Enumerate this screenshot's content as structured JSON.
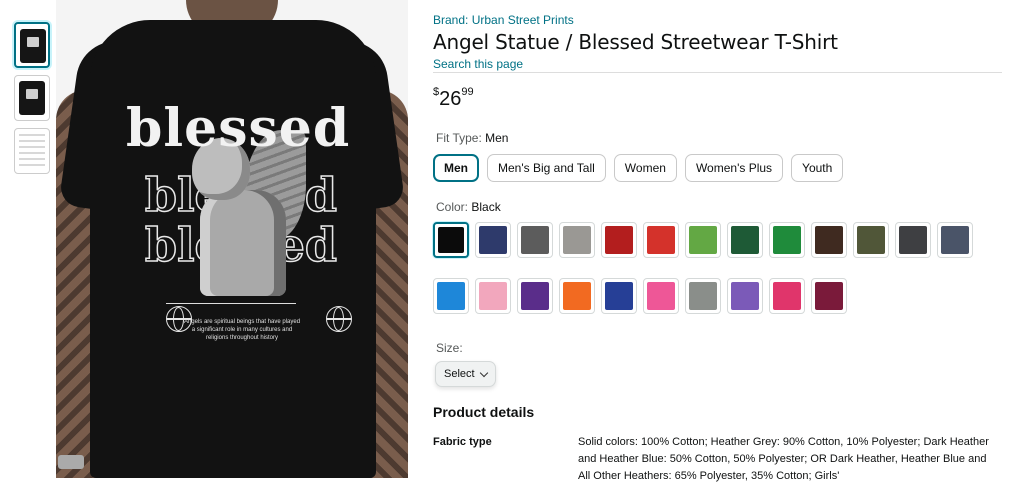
{
  "thumbnails": [
    "shirt-back-print",
    "shirt-front",
    "size-chart"
  ],
  "print": {
    "headline": "blessed",
    "outline_word": "blessed",
    "caption": "Angels are spiritual beings that have played a significant role in many cultures and religions throughout history"
  },
  "brand_link": "Brand: Urban Street Prints",
  "title": "Angel Statue / Blessed Streetwear T-Shirt",
  "search_link": "Search this page",
  "price": {
    "symbol": "$",
    "whole": "26",
    "fraction": "99"
  },
  "fit_type": {
    "label": "Fit Type:",
    "selected": "Men",
    "options": [
      "Men",
      "Men's Big and Tall",
      "Women",
      "Women's Plus",
      "Youth"
    ]
  },
  "color": {
    "label": "Color:",
    "selected": "Black",
    "swatches": [
      "#0b0b0b",
      "#2e3a6b",
      "#5c5c5c",
      "#9a9894",
      "#b31e1e",
      "#d4322b",
      "#63a844",
      "#1e5a36",
      "#1f8b3b",
      "#3f2a20",
      "#505638",
      "#3e3f42",
      "#4a5468",
      "#1e87d9",
      "#f2a7bd",
      "#5a2d8a",
      "#f26a21",
      "#263f96",
      "#ee5797",
      "#8a8e8a",
      "#7b5ab8",
      "#e0356b",
      "#7a1a3a"
    ]
  },
  "size": {
    "label": "Size:",
    "select_label": "Select"
  },
  "details": {
    "heading": "Product details",
    "fabric_label": "Fabric type",
    "fabric_value": "Solid colors: 100% Cotton; Heather Grey: 90% Cotton, 10% Polyester; Dark Heather and Heather Blue: 50% Cotton, 50% Polyester; OR Dark Heather, Heather Blue and All Other Heathers: 65% Polyester, 35% Cotton; Girls'"
  }
}
